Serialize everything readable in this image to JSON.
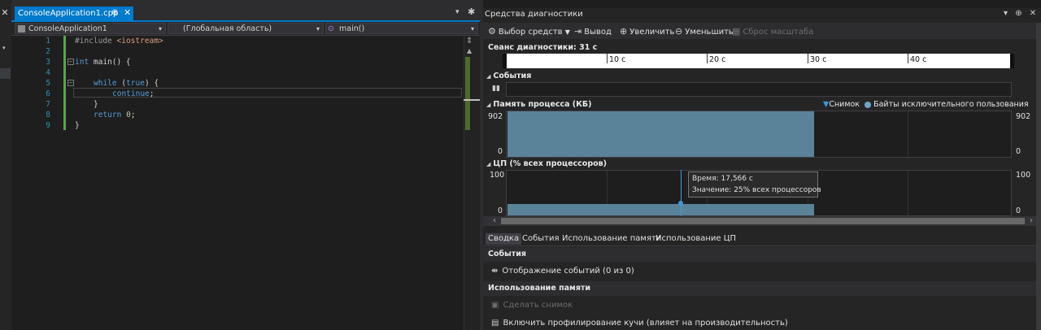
{
  "left_strip": {
    "close_glyph": "✕",
    "arrow_glyph": "▾"
  },
  "editor": {
    "tab": {
      "title": "ConsoleApplication1.cpp",
      "pin": "⊕",
      "close": "✕"
    },
    "tab_dropdown": "▾",
    "gear": "✱",
    "nav": {
      "project": "ConsoleApplication1",
      "scope": "(Глобальная область)",
      "function": "main()",
      "arrow": "▾"
    },
    "lines": [
      {
        "num": "1"
      },
      {
        "num": "2"
      },
      {
        "num": "3"
      },
      {
        "num": "4"
      },
      {
        "num": "5"
      },
      {
        "num": "6"
      },
      {
        "num": "7"
      },
      {
        "num": "8"
      },
      {
        "num": "9"
      }
    ],
    "code": {
      "l1_pp": "#include",
      "l1_inc": "<iostream>",
      "l3_kw": "int",
      "l3_rest": " main() {",
      "l5_kw": "while",
      "l5_a": " (",
      "l5_kw2": "true",
      "l5_b": ") {",
      "l6_kw": "continue",
      "l6_rest": ";",
      "l7": "}",
      "l8_kw": "return",
      "l8_num": "0",
      "l8_rest": ";",
      "l9": "}"
    },
    "fold_glyph": "−"
  },
  "diagnostics": {
    "title": "Средства диагностики",
    "window_controls": "▾ ⊕ ✕",
    "toolbar": {
      "select_tools": "Выбор средств",
      "output": "Вывод",
      "zoom_in": "Увеличить",
      "zoom_out": "Уменьшить",
      "reset_zoom": "Сброс масштаба"
    },
    "session": "Сеанс диагностики: 31 с",
    "ruler": {
      "ticks": [
        "10 с",
        "20 с",
        "30 с",
        "40 с"
      ]
    },
    "events_title": "События",
    "memory": {
      "title": "Память процесса (КБ)",
      "legend_snapshot": "Снимок",
      "legend_bytes": "Байты исключительного пользования",
      "y_max": "902",
      "y_min": "0",
      "value": 902
    },
    "cpu": {
      "title": "ЦП (% всех процессоров)",
      "y_max": "100",
      "y_min": "0",
      "value_pct": 25,
      "tooltip_time": "Время: 17,566 с",
      "tooltip_value": "Значение: 25% всех процессоров"
    },
    "tabs": [
      "Сводка",
      "События",
      "Использование памяти",
      "Использование ЦП"
    ],
    "summary": {
      "events_head": "События",
      "events_item": "Отображение событий (0 из 0)",
      "memory_head": "Использование памяти",
      "snapshot_item": "Сделать снимок",
      "heap_item": "Включить профилирование кучи (влияет на производительность)"
    }
  },
  "colors": {
    "accent": "#007acc",
    "chart_fill": "#5a8399",
    "cursor": "#3a9ad9"
  }
}
